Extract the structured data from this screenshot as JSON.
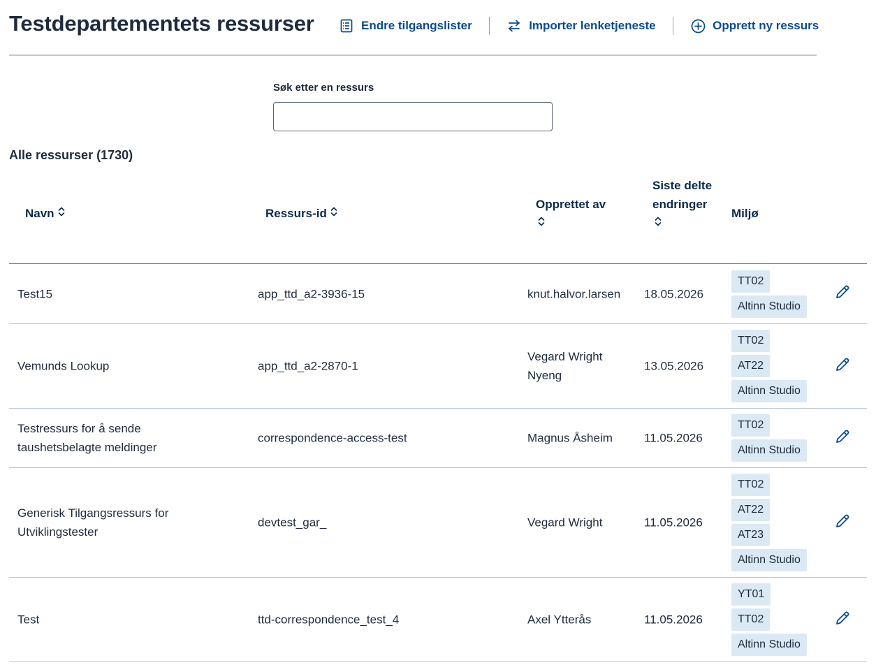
{
  "page": {
    "title": "Testdepartementets ressurser"
  },
  "actions": {
    "edit_access_lists": "Endre tilgangslister",
    "import_link_service": "Importer lenketjeneste",
    "create_resource": "Opprett ny ressurs"
  },
  "search": {
    "label": "Søk etter en ressurs",
    "value": "",
    "placeholder": ""
  },
  "list": {
    "heading": "Alle ressurser (1730)"
  },
  "table": {
    "headers": {
      "name": "Navn",
      "resource_id": "Ressurs-id",
      "created_by": "Opprettet av",
      "last_shared": "Siste delte endringer",
      "environment": "Miljø"
    },
    "rows": [
      {
        "name": "Test15",
        "resource_id": "app_ttd_a2-3936-15",
        "created_by": "knut.halvor.larsen",
        "date": "18.05.2026",
        "envs": [
          "TT02",
          "Altinn Studio"
        ]
      },
      {
        "name": "Vemunds Lookup",
        "resource_id": "app_ttd_a2-2870-1",
        "created_by": "Vegard Wright Nyeng",
        "date": "13.05.2026",
        "envs": [
          "TT02",
          "AT22",
          "Altinn Studio"
        ]
      },
      {
        "name": "Testressurs for å sende taushetsbelagte meldinger",
        "resource_id": "correspondence-access-test",
        "created_by": "Magnus Åsheim",
        "date": "11.05.2026",
        "envs": [
          "TT02",
          "Altinn Studio"
        ]
      },
      {
        "name": "Generisk Tilgangsressurs for Utviklingstester",
        "resource_id": "devtest_gar_",
        "created_by": "Vegard Wright",
        "date": "11.05.2026",
        "envs": [
          "TT02",
          "AT22",
          "AT23",
          "Altinn Studio"
        ]
      },
      {
        "name": "Test",
        "resource_id": "ttd-correspondence_test_4",
        "created_by": "Axel Ytterås",
        "date": "11.05.2026",
        "envs": [
          "YT01",
          "TT02",
          "Altinn Studio"
        ]
      }
    ]
  },
  "icons": {
    "edit_access_lists": "checklist-icon",
    "import_link_service": "arrows-swap-icon",
    "create_resource": "plus-circle-icon",
    "sort": "sort-chevrons-icon",
    "edit_row": "pencil-icon"
  },
  "colors": {
    "action_link": "#0a4b8c",
    "header_text": "#0b2a4a",
    "tag_bg": "#dbe9f5",
    "row_border": "#b7c4d1"
  }
}
